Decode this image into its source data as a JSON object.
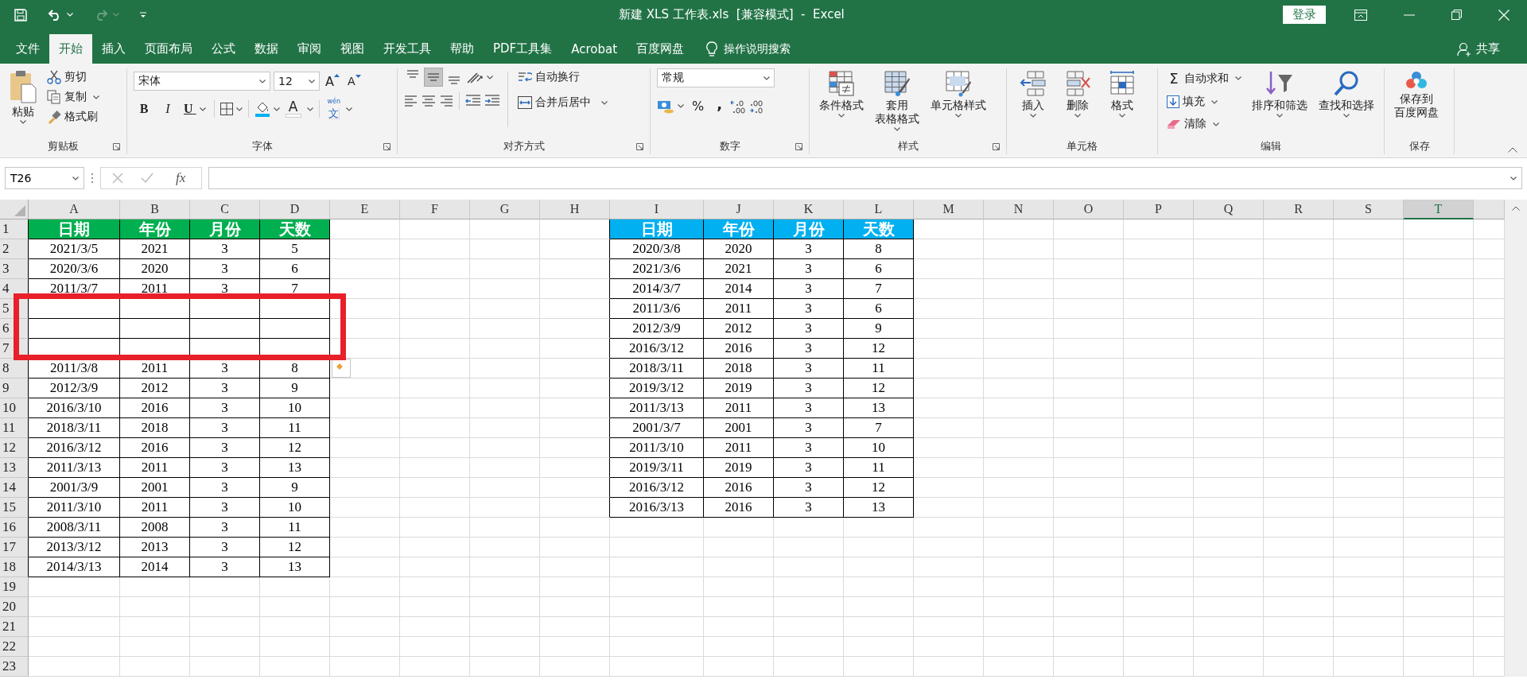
{
  "window": {
    "title": "新建 XLS 工作表.xls  [兼容模式]  -  Excel",
    "login": "登录"
  },
  "menu_tabs": [
    {
      "label": "文件",
      "selected": false
    },
    {
      "label": "开始",
      "selected": true
    },
    {
      "label": "插入",
      "selected": false
    },
    {
      "label": "页面布局",
      "selected": false
    },
    {
      "label": "公式",
      "selected": false
    },
    {
      "label": "数据",
      "selected": false
    },
    {
      "label": "审阅",
      "selected": false
    },
    {
      "label": "视图",
      "selected": false
    },
    {
      "label": "开发工具",
      "selected": false
    },
    {
      "label": "帮助",
      "selected": false
    },
    {
      "label": "PDF工具集",
      "selected": false
    },
    {
      "label": "Acrobat",
      "selected": false
    },
    {
      "label": "百度网盘",
      "selected": false
    }
  ],
  "tell_me": "操作说明搜索",
  "share": "共享",
  "ribbon": {
    "groups": [
      {
        "kind": "clipboard",
        "label": "剪贴板",
        "paste": "粘贴",
        "items": [
          "剪切",
          "复制",
          "格式刷"
        ]
      },
      {
        "kind": "font",
        "label": "字体",
        "font_name": "宋体",
        "font_size": "12",
        "grow": "A",
        "shrink": "A",
        "bold": "B",
        "italic": "I",
        "underline": "U",
        "font_color": "A",
        "phonetic_guide": "wén",
        "phonetic": "文"
      },
      {
        "kind": "alignment",
        "label": "对齐方式",
        "vertical": [
          {
            "selected": false
          },
          {
            "selected": true
          },
          {
            "selected": false
          }
        ],
        "wrap": "自动换行",
        "merge": "合并后居中"
      },
      {
        "kind": "number",
        "label": "数字",
        "format": "常规",
        "percent": "%",
        "comma": ","
      },
      {
        "kind": "styles",
        "label": "样式",
        "items": [
          {
            "lines": [
              "条件格式"
            ]
          },
          {
            "lines": [
              "套用",
              "表格格式"
            ]
          },
          {
            "lines": [
              "单元格样式"
            ]
          }
        ]
      },
      {
        "kind": "cells",
        "label": "单元格",
        "items": [
          "插入",
          "删除",
          "格式"
        ]
      },
      {
        "kind": "editing",
        "label": "编辑",
        "small": [
          {
            "glyph": "Σ",
            "label": "自动求和"
          },
          {
            "label": "填充"
          },
          {
            "label": "清除"
          }
        ],
        "big": [
          "排序和筛选",
          "查找和选择"
        ]
      },
      {
        "kind": "save",
        "label": "保存",
        "items": [
          {
            "lines": [
              "保存到",
              "百度网盘"
            ]
          }
        ]
      }
    ]
  },
  "formula_bar": {
    "name_box": "T26",
    "fx": "fx"
  },
  "sheet": {
    "columns": [
      {
        "label": "A",
        "selected": false
      },
      {
        "label": "B",
        "selected": false
      },
      {
        "label": "C",
        "selected": false
      },
      {
        "label": "D",
        "selected": false
      },
      {
        "label": "E",
        "selected": false
      },
      {
        "label": "F",
        "selected": false
      },
      {
        "label": "G",
        "selected": false
      },
      {
        "label": "H",
        "selected": false
      },
      {
        "label": "I",
        "selected": false
      },
      {
        "label": "J",
        "selected": false
      },
      {
        "label": "K",
        "selected": false
      },
      {
        "label": "L",
        "selected": false
      },
      {
        "label": "M",
        "selected": false
      },
      {
        "label": "N",
        "selected": false
      },
      {
        "label": "O",
        "selected": false
      },
      {
        "label": "P",
        "selected": false
      },
      {
        "label": "Q",
        "selected": false
      },
      {
        "label": "R",
        "selected": false
      },
      {
        "label": "S",
        "selected": false
      },
      {
        "label": "T",
        "selected": true
      }
    ],
    "row_numbers": [
      "1",
      "2",
      "3",
      "4",
      "5",
      "6",
      "7",
      "8",
      "9",
      "10",
      "11",
      "12",
      "13",
      "14",
      "15",
      "16",
      "17",
      "18",
      "19",
      "20",
      "21",
      "22",
      "23"
    ],
    "tables": [
      {
        "color": "#00b050",
        "header": [
          "日期",
          "年份",
          "月份",
          "天数"
        ],
        "rows": [
          {
            "kind": "data",
            "cells": [
              "2021/3/5",
              "2021",
              "3",
              "5"
            ]
          },
          {
            "kind": "data",
            "cells": [
              "2020/3/6",
              "2020",
              "3",
              "6"
            ]
          },
          {
            "kind": "data",
            "cells": [
              "2011/3/7",
              "2011",
              "3",
              "7"
            ]
          },
          {
            "kind": "blank"
          },
          {
            "kind": "blank"
          },
          {
            "kind": "blank"
          },
          {
            "kind": "data",
            "cells": [
              "2011/3/8",
              "2011",
              "3",
              "8"
            ]
          },
          {
            "kind": "data",
            "cells": [
              "2012/3/9",
              "2012",
              "3",
              "9"
            ]
          },
          {
            "kind": "data",
            "cells": [
              "2016/3/10",
              "2016",
              "3",
              "10"
            ]
          },
          {
            "kind": "data",
            "cells": [
              "2018/3/11",
              "2018",
              "3",
              "11"
            ]
          },
          {
            "kind": "data",
            "cells": [
              "2016/3/12",
              "2016",
              "3",
              "12"
            ]
          },
          {
            "kind": "data",
            "cells": [
              "2011/3/13",
              "2011",
              "3",
              "13"
            ]
          },
          {
            "kind": "data",
            "cells": [
              "2001/3/9",
              "2001",
              "3",
              "9"
            ]
          },
          {
            "kind": "data",
            "cells": [
              "2011/3/10",
              "2011",
              "3",
              "10"
            ]
          },
          {
            "kind": "data",
            "cells": [
              "2008/3/11",
              "2008",
              "3",
              "11"
            ]
          },
          {
            "kind": "data",
            "cells": [
              "2013/3/12",
              "2013",
              "3",
              "12"
            ]
          },
          {
            "kind": "data",
            "cells": [
              "2014/3/13",
              "2014",
              "3",
              "13"
            ]
          }
        ]
      },
      {
        "color": "#00b0f0",
        "header": [
          "日期",
          "年份",
          "月份",
          "天数"
        ],
        "rows": [
          {
            "kind": "data",
            "cells": [
              "2020/3/8",
              "2020",
              "3",
              "8"
            ]
          },
          {
            "kind": "data",
            "cells": [
              "2021/3/6",
              "2021",
              "3",
              "6"
            ]
          },
          {
            "kind": "data",
            "cells": [
              "2014/3/7",
              "2014",
              "3",
              "7"
            ]
          },
          {
            "kind": "data",
            "cells": [
              "2011/3/6",
              "2011",
              "3",
              "6"
            ]
          },
          {
            "kind": "data",
            "cells": [
              "2012/3/9",
              "2012",
              "3",
              "9"
            ]
          },
          {
            "kind": "data",
            "cells": [
              "2016/3/12",
              "2016",
              "3",
              "12"
            ]
          },
          {
            "kind": "data",
            "cells": [
              "2018/3/11",
              "2018",
              "3",
              "11"
            ]
          },
          {
            "kind": "data",
            "cells": [
              "2019/3/12",
              "2019",
              "3",
              "12"
            ]
          },
          {
            "kind": "data",
            "cells": [
              "2011/3/13",
              "2011",
              "3",
              "13"
            ]
          },
          {
            "kind": "data",
            "cells": [
              "2001/3/7",
              "2001",
              "3",
              "7"
            ]
          },
          {
            "kind": "data",
            "cells": [
              "2011/3/10",
              "2011",
              "3",
              "10"
            ]
          },
          {
            "kind": "data",
            "cells": [
              "2019/3/11",
              "2019",
              "3",
              "11"
            ]
          },
          {
            "kind": "data",
            "cells": [
              "2016/3/12",
              "2016",
              "3",
              "12"
            ]
          },
          {
            "kind": "data",
            "cells": [
              "2016/3/13",
              "2016",
              "3",
              "13"
            ]
          }
        ]
      }
    ]
  }
}
